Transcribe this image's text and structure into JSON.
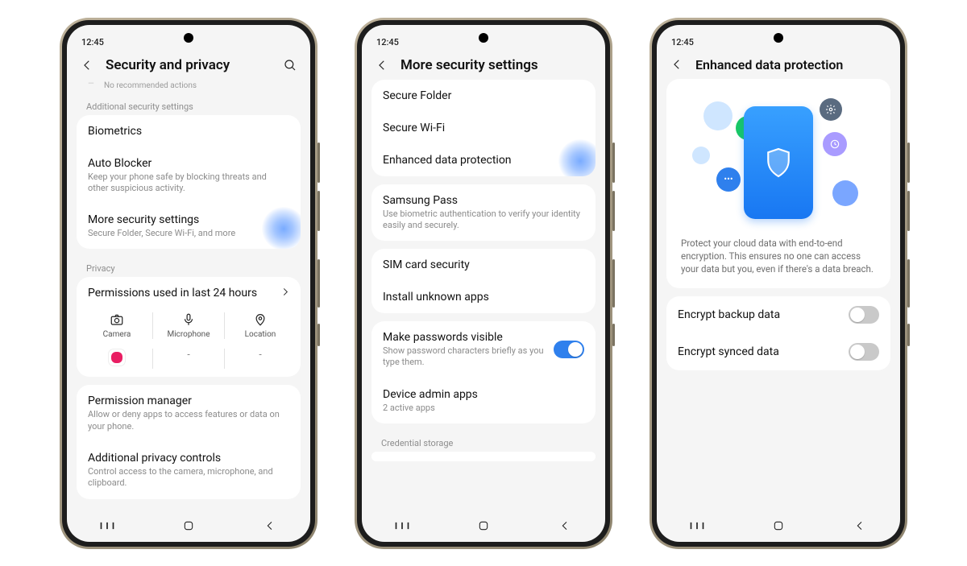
{
  "status_time": "12:45",
  "screen1": {
    "title": "Security and privacy",
    "faded": "No recommended actions",
    "section_additional": "Additional security settings",
    "biometrics": "Biometrics",
    "autoblocker_label": "Auto Blocker",
    "autoblocker_sub": "Keep your phone safe by blocking threats and other suspicious activity.",
    "more_label": "More security settings",
    "more_sub": "Secure Folder, Secure Wi-Fi, and more",
    "section_privacy": "Privacy",
    "perm_used_label": "Permissions used in last 24 hours",
    "perm_cols": {
      "camera": "Camera",
      "mic": "Microphone",
      "location": "Location"
    },
    "perm_vals": {
      "camera": "",
      "mic": "-",
      "location": "-"
    },
    "perm_mgr_label": "Permission manager",
    "perm_mgr_sub": "Allow or deny apps to access features or data on your phone.",
    "addl_priv_label": "Additional privacy controls",
    "addl_priv_sub": "Control access to the camera, microphone, and clipboard."
  },
  "screen2": {
    "title": "More security settings",
    "items": {
      "secure_folder": "Secure Folder",
      "secure_wifi": "Secure Wi-Fi",
      "enhanced": "Enhanced data protection",
      "samsung_pass": "Samsung Pass",
      "samsung_pass_sub": "Use biometric authentication to verify your identity easily and securely.",
      "sim": "SIM card security",
      "install_unknown": "Install unknown apps",
      "make_pw": "Make passwords visible",
      "make_pw_sub": "Show password characters briefly as you type them.",
      "device_admin": "Device admin apps",
      "device_admin_sub": "2 active apps",
      "cred_storage": "Credential storage"
    }
  },
  "screen3": {
    "title": "Enhanced data protection",
    "hero_text": "Protect your cloud data with end-to-end encryption. This ensures no one can access your data but you, even if there's a data breach.",
    "encrypt_backup": "Encrypt backup data",
    "encrypt_synced": "Encrypt synced data"
  }
}
